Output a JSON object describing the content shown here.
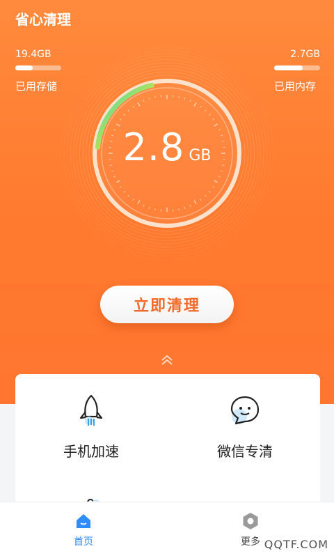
{
  "app": {
    "title": "省心清理"
  },
  "storage": {
    "value": "19.4GB",
    "label": "已用存储",
    "fill": 0.38
  },
  "memory": {
    "value": "2.7GB",
    "label": "已用内存",
    "fill": 0.62
  },
  "gauge": {
    "value": "2.8",
    "unit": "GB",
    "progress": 0.28
  },
  "actions": {
    "clean_label": "立即清理"
  },
  "tools": [
    {
      "label": "手机加速",
      "icon": "rocket-icon"
    },
    {
      "label": "微信专清",
      "icon": "chat-icon"
    }
  ],
  "tabbar": {
    "home_label": "首页",
    "more_label": "更多"
  },
  "watermark": "QQTF.COM",
  "colors": {
    "accent": "#ff7a2e",
    "button_text": "#f26a2a",
    "tab_active": "#2f8cff"
  }
}
